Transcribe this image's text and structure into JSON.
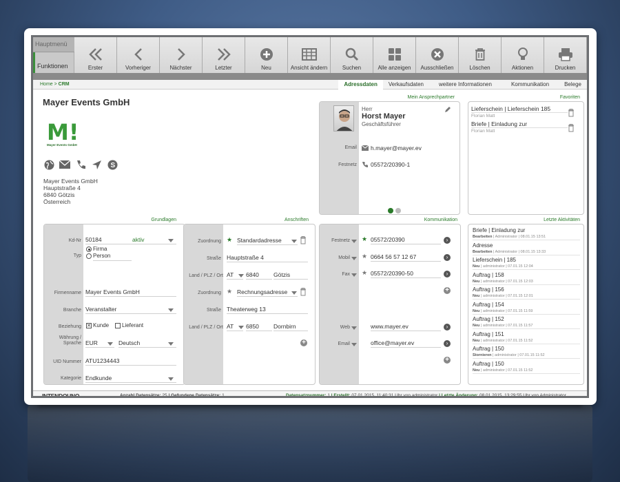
{
  "toolbar": {
    "haupt": "Hauptmenü",
    "funk": "Funktionen",
    "buttons": [
      {
        "label": "Erster",
        "icon": "double-left-icon"
      },
      {
        "label": "Vorheriger",
        "icon": "left-icon"
      },
      {
        "label": "Nächster",
        "icon": "right-icon"
      },
      {
        "label": "Letzter",
        "icon": "double-right-icon"
      },
      {
        "label": "Neu",
        "icon": "plus-circle-icon"
      },
      {
        "label": "Ansicht ändern",
        "icon": "grid-icon"
      },
      {
        "label": "Suchen",
        "icon": "search-icon"
      },
      {
        "label": "Alle anzeigen",
        "icon": "tiles-icon"
      },
      {
        "label": "Ausschließen",
        "icon": "x-circle-icon"
      },
      {
        "label": "Löschen",
        "icon": "trash-icon"
      },
      {
        "label": "Aktionen",
        "icon": "bulb-icon"
      },
      {
        "label": "Drucken",
        "icon": "printer-icon"
      }
    ]
  },
  "breadcrumb": {
    "home": "Home",
    "sep": " > ",
    "crm": "CRM"
  },
  "tabs": [
    "Adressdaten",
    "Verkaufsdaten",
    "weitere Informationen",
    "Kommunikation",
    "Belege"
  ],
  "company": {
    "name": "Mayer Events GmbH",
    "logo_letter": "M!",
    "logo_sub": "Mayer Events GmbH",
    "addr1": "Mayer Events GmbH",
    "addr2": "Hauptstraße 4",
    "addr3": "6840 Götzis",
    "addr4": "Österreich"
  },
  "contact": {
    "label": "Mein Ansprechpartner",
    "salutation": "Herr",
    "name": "Horst Mayer",
    "role": "Geschäftsführer",
    "email_label": "Email",
    "email": "h.mayer@mayer.ev",
    "phone_label": "Festnetz",
    "phone": "05572/20390-1"
  },
  "favorites": {
    "label": "Favoriten",
    "items": [
      {
        "title": "Lieferschein | Lieferschein 185",
        "sub": "Florian Matt"
      },
      {
        "title": "Briefe | Einladung zur",
        "sub": "Florian Matt"
      }
    ]
  },
  "grund": {
    "label": "Grundlagen",
    "kdnr_label": "Kd-Nr",
    "kdnr": "50184",
    "status": "aktiv",
    "typ_label": "Typ",
    "firma": "Firma",
    "person": "Person",
    "firmenname_label": "Firmenname",
    "firmenname": "Mayer Events GmbH",
    "branche_label": "Branche",
    "branche": "Veranstalter",
    "beziehung_label": "Beziehung",
    "kunde": "Kunde",
    "lieferant": "Lieferant",
    "wahrung_label1": "Währung /",
    "wahrung_label2": "Sprache",
    "currency": "EUR",
    "language": "Deutsch",
    "uid_label": "UID Nummer",
    "uid": "ATU1234443",
    "kategorie_label": "Kategorie",
    "kategorie": "Endkunde"
  },
  "ansch": {
    "label": "Anschriften",
    "zuord_label": "Zuordnung",
    "strasse_label": "Straße",
    "land_label": "Land / PLZ / Ort",
    "a1_type": "Standardadresse",
    "a1_street": "Hauptstraße 4",
    "a1_country": "AT",
    "a1_zip": "6840",
    "a1_city": "Götzis",
    "a2_type": "Rechnungsadresse",
    "a2_street": "Theaterweg 13",
    "a2_country": "AT",
    "a2_zip": "6850",
    "a2_city": "Dornbirn"
  },
  "komm": {
    "label": "Kommunikation",
    "festnetz_label": "Festnetz",
    "festnetz": "05572/20390",
    "mobil_label": "Mobil",
    "mobil": "0664 56 57 12 67",
    "fax_label": "Fax",
    "fax": "05572/20390-50",
    "web_label": "Web",
    "web": "www.mayer.ev",
    "email_label": "Email",
    "email": "office@mayer.ev"
  },
  "activities": {
    "label": "Letzte Aktivitäten",
    "items": [
      {
        "title": "Briefe | Einladung zur",
        "action": "Bearbeiten",
        "meta": "| Administrator | 08.01.15 13:51"
      },
      {
        "title": "Adresse",
        "action": "Bearbeiten",
        "meta": "| Administrator | 08.01.15 13:33"
      },
      {
        "title": "Lieferschein | 185",
        "action": "Neu",
        "meta": "| administrator | 07.01.15 12:04"
      },
      {
        "title": "Auftrag | 158",
        "action": "Neu",
        "meta": "| administrator | 07.01.15 12:03"
      },
      {
        "title": "Auftrag | 156",
        "action": "Neu",
        "meta": "| administrator | 07.01.15 12:01"
      },
      {
        "title": "Auftrag | 154",
        "action": "Neu",
        "meta": "| administrator | 07.01.15 11:59"
      },
      {
        "title": "Auftrag | 152",
        "action": "Neu",
        "meta": "| administrator | 07.01.15 11:57"
      },
      {
        "title": "Auftrag | 151",
        "action": "Neu",
        "meta": "| administrator | 07.01.15 11:52"
      },
      {
        "title": "Auftrag | 150",
        "action": "Stornieren",
        "meta": "| administrator | 07.01.15 11:52"
      },
      {
        "title": "Auftrag | 150",
        "action": "Neu",
        "meta": "| administrator | 07.01.15 11:52"
      }
    ]
  },
  "status": {
    "brand": "INTENDOUNO",
    "count_label": "Anzahl Datensätze:",
    "count": "25",
    "found_label": "| Gefundene Datensätze:",
    "found": "1",
    "record_label": "Datensatznummer:",
    "record": "1",
    "created_label": "| Erstellt:",
    "created": "07.01.2015. 11:40:31 Uhr von administrator",
    "changed_label": "| Letzte Änderung:",
    "changed": "08.01.2015. 13:29:55 Uhr von Administrator"
  },
  "colors": {
    "accent": "#2a7a2a",
    "toolbar": "#dcdcdc"
  }
}
